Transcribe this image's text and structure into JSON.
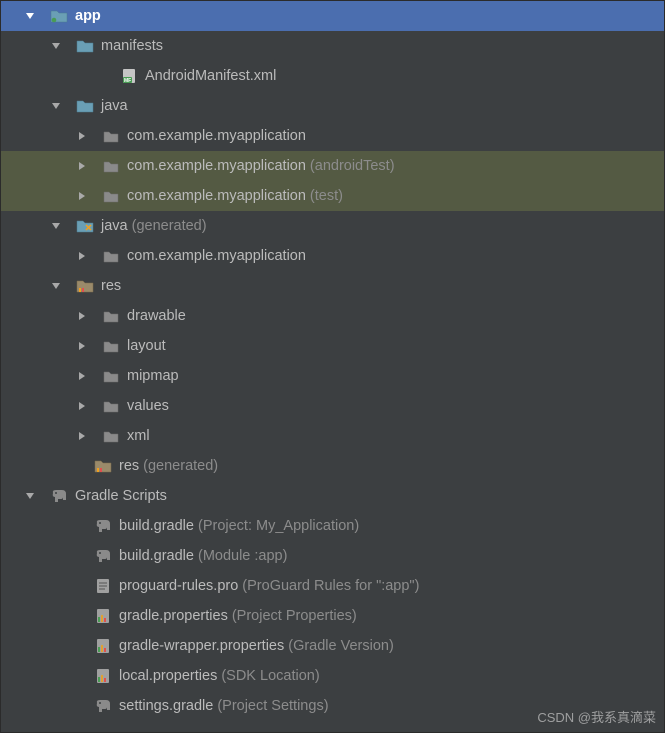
{
  "tree": [
    {
      "level": 0,
      "chev": "down",
      "icon": "folder-blue-dot",
      "label": "app",
      "bold": true,
      "selected": true
    },
    {
      "level": 1,
      "chev": "down",
      "icon": "folder-blue",
      "label": "manifests"
    },
    {
      "level": 2,
      "chev": "none",
      "icon": "manifest",
      "label": "AndroidManifest.xml"
    },
    {
      "level": 1,
      "chev": "down",
      "icon": "folder-blue",
      "label": "java"
    },
    {
      "level": 2,
      "chev": "right",
      "icon": "package",
      "label": "com.example.myapplication"
    },
    {
      "level": 2,
      "chev": "right",
      "icon": "package",
      "label": "com.example.myapplication",
      "suffix": "(androidTest)",
      "highlight": true
    },
    {
      "level": 2,
      "chev": "right",
      "icon": "package",
      "label": "com.example.myapplication",
      "suffix": "(test)",
      "highlight": true
    },
    {
      "level": 1,
      "chev": "down",
      "icon": "folder-gen",
      "label": "java",
      "suffix": "(generated)"
    },
    {
      "level": 2,
      "chev": "right",
      "icon": "package",
      "label": "com.example.myapplication"
    },
    {
      "level": 1,
      "chev": "down",
      "icon": "folder-res",
      "label": "res"
    },
    {
      "level": 2,
      "chev": "right",
      "icon": "package",
      "label": "drawable"
    },
    {
      "level": 2,
      "chev": "right",
      "icon": "package",
      "label": "layout"
    },
    {
      "level": 2,
      "chev": "right",
      "icon": "package",
      "label": "mipmap"
    },
    {
      "level": 2,
      "chev": "right",
      "icon": "package",
      "label": "values"
    },
    {
      "level": 2,
      "chev": "right",
      "icon": "package",
      "label": "xml"
    },
    {
      "level": 1,
      "chev": "none",
      "icon": "folder-res",
      "label": "res",
      "suffix": "(generated)"
    },
    {
      "level": 0,
      "chev": "down",
      "icon": "elephant",
      "label": "Gradle Scripts"
    },
    {
      "level": 1,
      "chev": "none",
      "icon": "elephant",
      "label": "build.gradle",
      "suffix": "(Project: My_Application)"
    },
    {
      "level": 1,
      "chev": "none",
      "icon": "elephant",
      "label": "build.gradle",
      "suffix": "(Module :app)"
    },
    {
      "level": 1,
      "chev": "none",
      "icon": "textfile",
      "label": "proguard-rules.pro",
      "suffix": "(ProGuard Rules for \":app\")"
    },
    {
      "level": 1,
      "chev": "none",
      "icon": "properties",
      "label": "gradle.properties",
      "suffix": "(Project Properties)"
    },
    {
      "level": 1,
      "chev": "none",
      "icon": "properties",
      "label": "gradle-wrapper.properties",
      "suffix": "(Gradle Version)"
    },
    {
      "level": 1,
      "chev": "none",
      "icon": "properties",
      "label": "local.properties",
      "suffix": "(SDK Location)"
    },
    {
      "level": 1,
      "chev": "none",
      "icon": "elephant",
      "label": "settings.gradle",
      "suffix": "(Project Settings)"
    }
  ],
  "watermark": "CSDN @我系真滴菜"
}
